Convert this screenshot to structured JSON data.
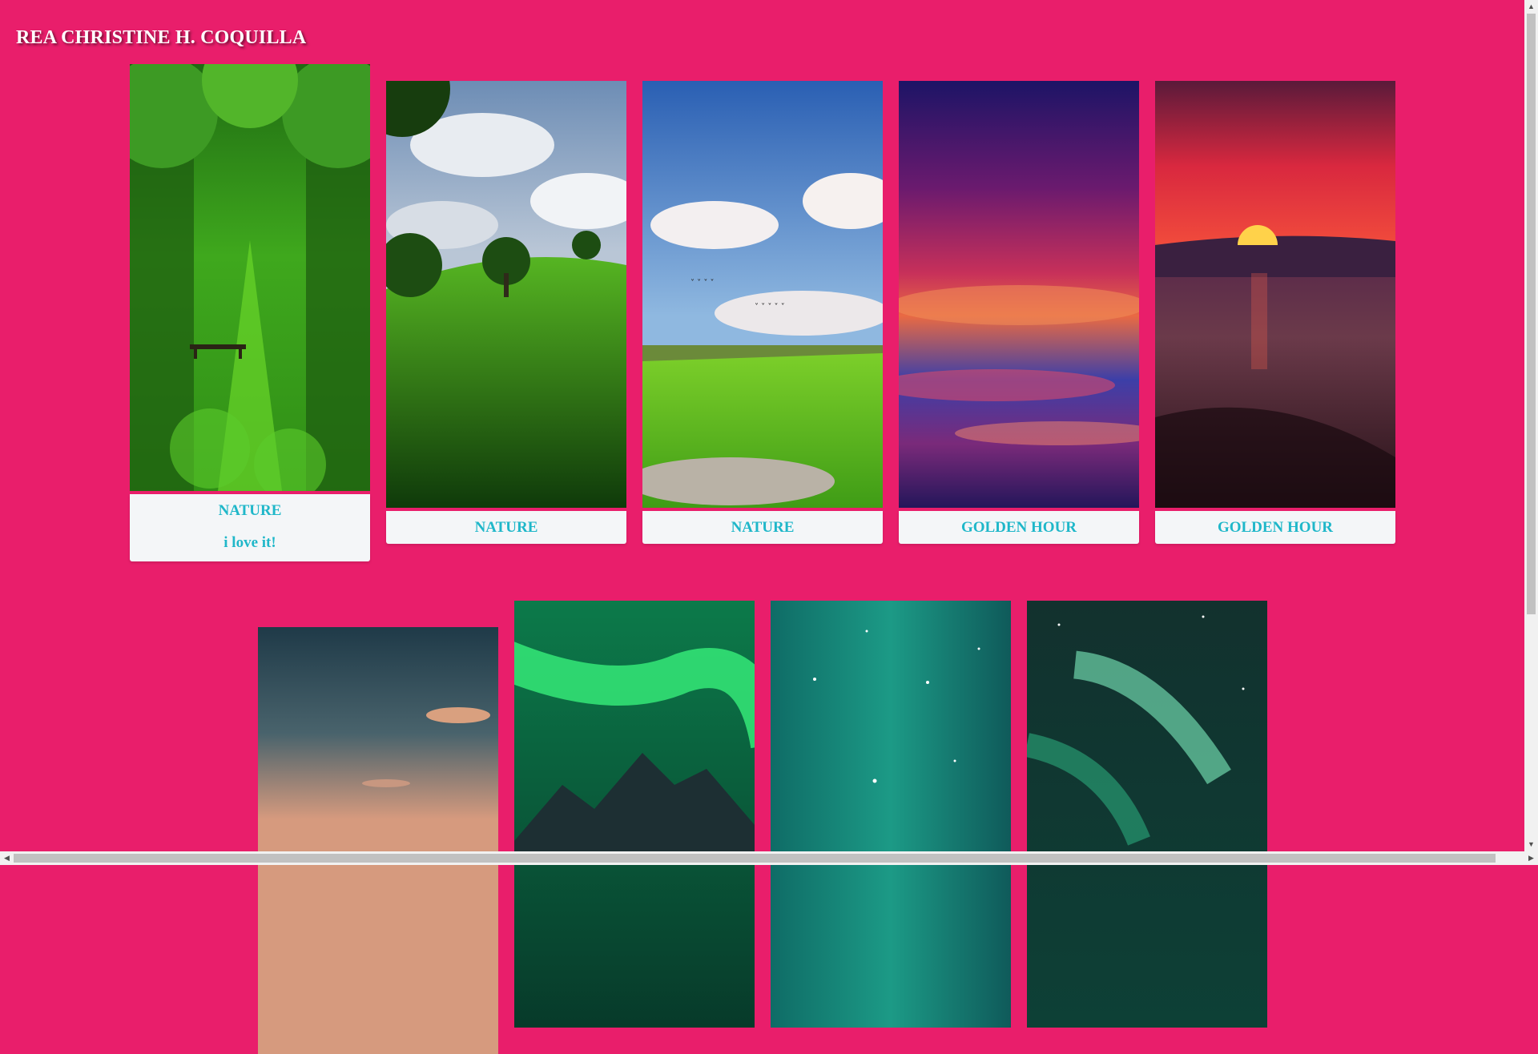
{
  "header": {
    "title": "REA CHRISTINE H. COQUILLA"
  },
  "gallery": {
    "row1": [
      {
        "caption": "NATURE",
        "subcaption": "i love it!",
        "image": "forest-path-bench-photo"
      },
      {
        "caption": "NATURE",
        "image": "green-hill-tree-photo"
      },
      {
        "caption": "NATURE",
        "image": "meadow-sky-birds-photo"
      },
      {
        "caption": "GOLDEN HOUR",
        "image": "purple-sunset-clouds-photo"
      },
      {
        "caption": "GOLDEN HOUR",
        "image": "red-sunset-sea-photo"
      }
    ],
    "row2": [
      {
        "image": "dusk-sky-photo"
      },
      {
        "image": "aurora-mountain-photo"
      },
      {
        "image": "teal-aurora-stars-photo"
      },
      {
        "image": "green-aurora-swirl-photo"
      }
    ]
  },
  "colors": {
    "background": "#e91e6b",
    "caption_text": "#1fb7c9",
    "caption_bg": "#f4f6f8"
  }
}
